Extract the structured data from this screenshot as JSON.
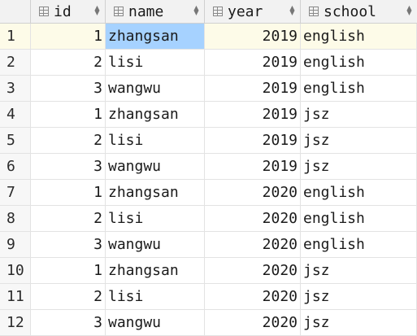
{
  "columns": [
    {
      "key": "id",
      "label": "id"
    },
    {
      "key": "name",
      "label": "name"
    },
    {
      "key": "year",
      "label": "year"
    },
    {
      "key": "school",
      "label": "school"
    }
  ],
  "rows": [
    {
      "n": "1",
      "id": "1",
      "name": "zhangsan",
      "year": "2019",
      "school": "english"
    },
    {
      "n": "2",
      "id": "2",
      "name": "lisi",
      "year": "2019",
      "school": "english"
    },
    {
      "n": "3",
      "id": "3",
      "name": "wangwu",
      "year": "2019",
      "school": "english"
    },
    {
      "n": "4",
      "id": "1",
      "name": "zhangsan",
      "year": "2019",
      "school": "jsz"
    },
    {
      "n": "5",
      "id": "2",
      "name": "lisi",
      "year": "2019",
      "school": "jsz"
    },
    {
      "n": "6",
      "id": "3",
      "name": "wangwu",
      "year": "2019",
      "school": "jsz"
    },
    {
      "n": "7",
      "id": "1",
      "name": "zhangsan",
      "year": "2020",
      "school": "english"
    },
    {
      "n": "8",
      "id": "2",
      "name": "lisi",
      "year": "2020",
      "school": "english"
    },
    {
      "n": "9",
      "id": "3",
      "name": "wangwu",
      "year": "2020",
      "school": "english"
    },
    {
      "n": "10",
      "id": "1",
      "name": "zhangsan",
      "year": "2020",
      "school": "jsz"
    },
    {
      "n": "11",
      "id": "2",
      "name": "lisi",
      "year": "2020",
      "school": "jsz"
    },
    {
      "n": "12",
      "id": "3",
      "name": "wangwu",
      "year": "2020",
      "school": "jsz"
    }
  ],
  "selection": {
    "row": 1,
    "column": "name"
  },
  "colors": {
    "selected_cell": "#a6d2ff",
    "current_row": "#fdfbe8",
    "header_bg": "#f2f2f2"
  },
  "icons": {
    "column_header": "table-column-icon",
    "sort": "sort-arrows-icon"
  }
}
